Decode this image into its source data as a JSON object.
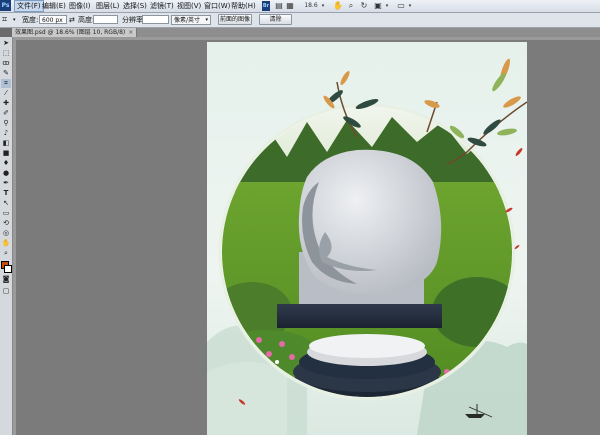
{
  "app": {
    "logo": "Ps"
  },
  "menubar": {
    "items": [
      {
        "label": "文件(F)",
        "active": true
      },
      {
        "label": "编辑(E)"
      },
      {
        "label": "图像(I)"
      },
      {
        "label": "图层(L)"
      },
      {
        "label": "选择(S)"
      },
      {
        "label": "滤镜(T)"
      },
      {
        "label": "视图(V)"
      },
      {
        "label": "窗口(W)"
      },
      {
        "label": "帮助(H)"
      }
    ],
    "zoom": "18.6"
  },
  "options": {
    "width_label": "宽度:",
    "width_value": "600 px",
    "height_label": "高度:",
    "height_value": "",
    "resolution_label": "分辨率:",
    "resolution_value": "",
    "unit_select": "像素/英寸",
    "front_image_button": "前面的图像",
    "clear_button": "清除"
  },
  "document_tab": {
    "title": "效果图.psd @ 18.6% (图层 10, RGB/8)",
    "close": "×"
  },
  "colors": {
    "foreground": "#c84a00",
    "background": "#ffffff"
  }
}
